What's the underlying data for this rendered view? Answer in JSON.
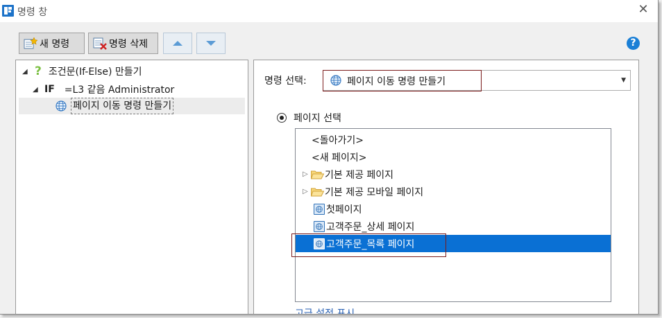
{
  "window": {
    "title": "명령 창"
  },
  "toolbar": {
    "new_label": "새 명령",
    "delete_label": "명령 삭제"
  },
  "tree": {
    "root_label": "조건문(If-Else) 만들기",
    "if_keyword": "IF",
    "condition": "=L3 같음 Administrator",
    "child_label": "페이지 이동 명령 만들기"
  },
  "command": {
    "label": "명령 선택:",
    "selected": "페이지 이동 명령 만들기"
  },
  "page_select": {
    "radio_label": "페이지 선택",
    "items": [
      {
        "label": "<돌아가기>",
        "kind": "text"
      },
      {
        "label": "<새 페이지>",
        "kind": "text"
      },
      {
        "label": "기본 제공 페이지",
        "kind": "folder"
      },
      {
        "label": "기본 제공 모바일 페이지",
        "kind": "folder"
      },
      {
        "label": "첫페이지",
        "kind": "page"
      },
      {
        "label": "고객주문_상세 페이지",
        "kind": "page"
      },
      {
        "label": "고객주문_목록 페이지",
        "kind": "page",
        "selected": true
      }
    ]
  },
  "bottom_link": "고급 설정 표시",
  "colors": {
    "selection": "#0a70d4",
    "highlight_box": "#7a1a1a",
    "accent": "#1a7fd6"
  }
}
